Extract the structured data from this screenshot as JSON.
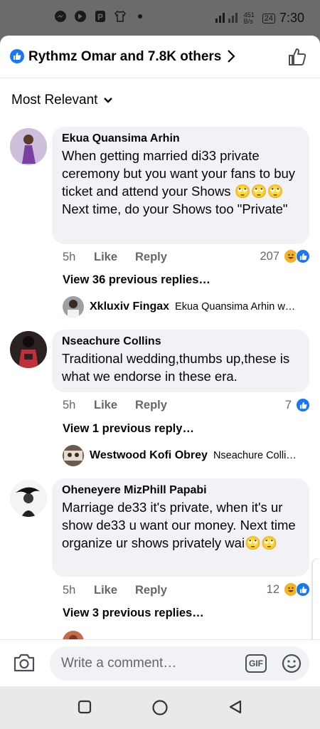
{
  "status_bar": {
    "network_speed": "451 B/s",
    "battery": "24",
    "time": "7:30",
    "icons": [
      "messenger-icon",
      "pocket-icon",
      "p-icon",
      "shirt-icon",
      "dot-icon",
      "signal-icon",
      "battery-icon"
    ]
  },
  "header": {
    "reactions_text": "Rythmz Omar and 7.8K others",
    "like_icon": "thumbs-up-icon",
    "accent": "#1877f2"
  },
  "sort": {
    "label": "Most Relevant"
  },
  "comments": [
    {
      "name": "Ekua Quansima Arhin",
      "text": "When getting married di33 private ceremony but you want your fans to buy ticket and attend your  Shows 🙄🙄🙄 Next time, do your Shows too \"Private\"",
      "time": "5h",
      "like": "Like",
      "reply": "Reply",
      "count": "207",
      "reactions": [
        "haha",
        "like"
      ],
      "view_replies": "View 36 previous replies…",
      "reply_preview": {
        "name": "Xkluxiv Fingax",
        "snippet": "Ekua Quansima Arhin w…"
      }
    },
    {
      "name": "Nseachure Collins",
      "text": "Traditional wedding,thumbs up,these is what we endorse in these era.",
      "time": "5h",
      "like": "Like",
      "reply": "Reply",
      "count": "7",
      "reactions": [
        "like"
      ],
      "view_replies": "View 1 previous reply…",
      "reply_preview": {
        "name": "Westwood Kofi Obrey",
        "snippet": "Nseachure Colli…"
      }
    },
    {
      "name": "Oheneyere MizPhill Papabi",
      "text": "Marriage de33 it's private, when it's ur show de33 u want our money. Next time organize ur shows privately wai🙄🙄",
      "time": "5h",
      "like": "Like",
      "reply": "Reply",
      "count": "12",
      "reactions": [
        "haha",
        "like"
      ],
      "view_replies": "View 3 previous replies…"
    }
  ],
  "composer": {
    "placeholder": "Write a comment…",
    "gif_label": "GIF",
    "camera_icon": "camera-icon",
    "emoji_icon": "smiley-icon"
  },
  "nav": {
    "icons": [
      "recents-square-icon",
      "home-circle-icon",
      "back-triangle-icon"
    ]
  }
}
